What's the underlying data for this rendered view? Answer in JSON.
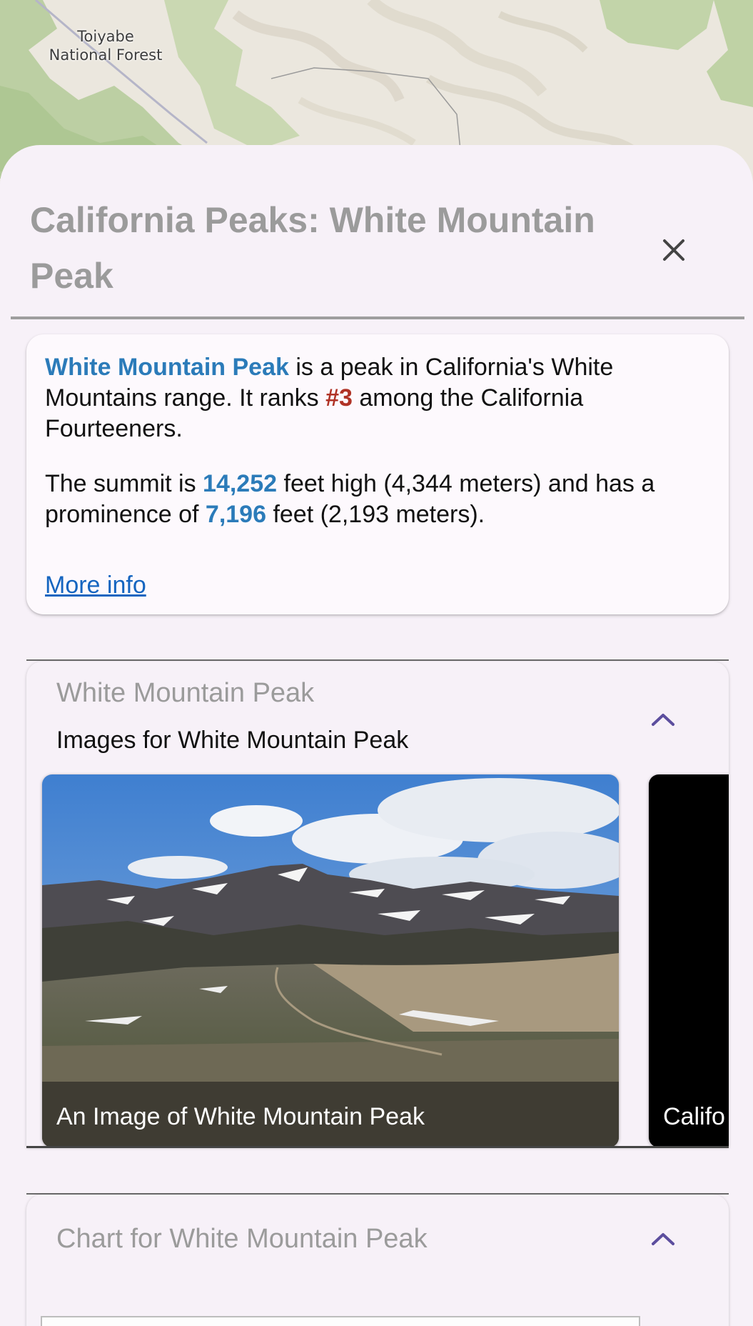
{
  "map": {
    "label": "Toiyabe\nNational Forest"
  },
  "sheet": {
    "title": "California Peaks: White Mountain Peak",
    "close_icon": "close-icon"
  },
  "info": {
    "peak_name": "White Mountain Peak",
    "sentence1_a": " is a peak in California's White Mountains range. It ranks ",
    "rank": "#3",
    "sentence1_b": " among the California Fourteeners.",
    "sentence2_a": "The summit is ",
    "elevation_ft": "14,252",
    "sentence2_b": " feet high (4,344 meters) and has a prominence of ",
    "prominence_ft": "7,196",
    "sentence2_c": " feet (2,193 meters).",
    "more_info_label": "More info",
    "colors": {
      "highlight": "#2b7bb9",
      "rank": "#b03326",
      "link": "#1565c0"
    }
  },
  "images_section": {
    "title": "White Mountain Peak",
    "subtitle": "Images for White Mountain Peak",
    "chevron_icon": "chevron-up-icon",
    "images": [
      {
        "caption": "An Image of White Mountain Peak"
      },
      {
        "caption": "Califo"
      }
    ]
  },
  "chart_section": {
    "title": "Chart for White Mountain Peak",
    "chevron_icon": "chevron-up-icon"
  }
}
